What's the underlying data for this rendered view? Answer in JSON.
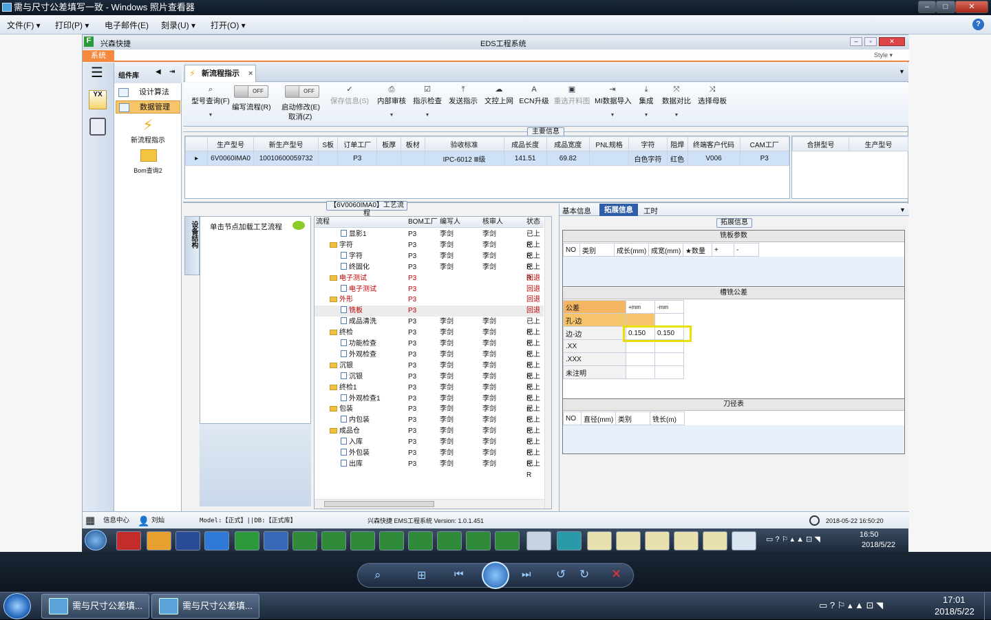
{
  "outer_window": {
    "title": "需与尺寸公差填写一致 - Windows 照片查看器",
    "min": "–",
    "max": "□",
    "close": "✕",
    "help": "?"
  },
  "outer_menu": [
    {
      "label": "文件(F)"
    },
    {
      "label": "打印(P)"
    },
    {
      "label": "电子邮件(E)"
    },
    {
      "label": "刻录(U)"
    },
    {
      "label": "打开(O)"
    }
  ],
  "eds": {
    "app_short": "兴森快捷",
    "title": "EDS工程系统",
    "style": "Style",
    "sys_tab": "系统"
  },
  "complib": {
    "title": "组件库",
    "items": [
      {
        "label": "设计算法"
      },
      {
        "label": "数据管理"
      }
    ],
    "big": [
      {
        "label": "新流程指示"
      },
      {
        "label": "Bom查询2"
      }
    ]
  },
  "doc_tab": {
    "label": "新流程指示",
    "close": "×"
  },
  "ribbon": {
    "query": "型号查询(F)",
    "edit_flow": "编写流程(R)",
    "enable_edit": "启动修改(E)",
    "cancel": "取消(Z)",
    "off": "OFF",
    "buttons": [
      {
        "label": "保存信息(S)",
        "disabled": true
      },
      {
        "label": "内部审核"
      },
      {
        "label": "指示检查"
      },
      {
        "label": "发送指示"
      },
      {
        "label": "文控上网"
      },
      {
        "label": "ECN升级"
      },
      {
        "label": "重选开料图",
        "disabled": true
      },
      {
        "label": "MI数据导入"
      },
      {
        "label": "集成"
      },
      {
        "label": "数据对比"
      },
      {
        "label": "选择母板"
      }
    ]
  },
  "main_info": {
    "title": "主要信息",
    "headers": [
      "生产型号",
      "新生产型号",
      "S板",
      "订单工厂",
      "板厚",
      "板材",
      "验收标准",
      "成品长度",
      "成品宽度",
      "PNL规格",
      "字符",
      "阻焊",
      "终端客户代码",
      "CAM工厂"
    ],
    "row": [
      "6V0060IMA0",
      "10010600059732",
      "",
      "P3",
      "",
      "",
      "IPC-6012 Ⅲ级",
      "141.51",
      "69.82",
      "",
      "白色字符",
      "红色",
      "V006",
      "P3"
    ],
    "side_headers": [
      "合拼型号",
      "生产型号"
    ]
  },
  "process": {
    "title": "【6V0060IMA0】工艺流程",
    "vertical_tab": "设备结构",
    "hint": "单击节点加载工艺流程",
    "headers": [
      "流程",
      "BOM工厂",
      "编写人",
      "核审人",
      "状态"
    ],
    "rows": [
      {
        "name": "显影1",
        "level": 2,
        "folder": false,
        "red": false,
        "bom": "P3",
        "author": "李剑",
        "checker": "李剑",
        "status": "已上R"
      },
      {
        "name": "字符",
        "level": 1,
        "folder": true,
        "red": false,
        "bom": "P3",
        "author": "李剑",
        "checker": "李剑",
        "status": "已上R"
      },
      {
        "name": "字符",
        "level": 2,
        "folder": false,
        "red": false,
        "bom": "P3",
        "author": "李剑",
        "checker": "李剑",
        "status": "已上R"
      },
      {
        "name": "终固化",
        "level": 2,
        "folder": false,
        "red": false,
        "bom": "P3",
        "author": "李剑",
        "checker": "李剑",
        "status": "已上R"
      },
      {
        "name": "电子测试",
        "level": 1,
        "folder": true,
        "red": true,
        "bom": "P3",
        "author": "",
        "checker": "",
        "status": "回退"
      },
      {
        "name": "电子测试",
        "level": 2,
        "folder": false,
        "red": true,
        "bom": "P3",
        "author": "",
        "checker": "",
        "status": "回退"
      },
      {
        "name": "外形",
        "level": 1,
        "folder": true,
        "red": true,
        "bom": "P3",
        "author": "",
        "checker": "",
        "status": "回退"
      },
      {
        "name": "铣板",
        "level": 2,
        "folder": false,
        "red": true,
        "bom": "P3",
        "author": "",
        "checker": "",
        "status": "回退",
        "hl": true
      },
      {
        "name": "成品清洗",
        "level": 2,
        "folder": false,
        "red": false,
        "bom": "P3",
        "author": "李剑",
        "checker": "李剑",
        "status": "已上R"
      },
      {
        "name": "终检",
        "level": 1,
        "folder": true,
        "red": false,
        "bom": "P3",
        "author": "李剑",
        "checker": "李剑",
        "status": "已上R"
      },
      {
        "name": "功能检查",
        "level": 2,
        "folder": false,
        "red": false,
        "bom": "P3",
        "author": "李剑",
        "checker": "李剑",
        "status": "已上R"
      },
      {
        "name": "外观检查",
        "level": 2,
        "folder": false,
        "red": false,
        "bom": "P3",
        "author": "李剑",
        "checker": "李剑",
        "status": "已上R"
      },
      {
        "name": "沉银",
        "level": 1,
        "folder": true,
        "red": false,
        "bom": "P3",
        "author": "李剑",
        "checker": "李剑",
        "status": "已上R"
      },
      {
        "name": "沉银",
        "level": 2,
        "folder": false,
        "red": false,
        "bom": "P3",
        "author": "李剑",
        "checker": "李剑",
        "status": "已上R"
      },
      {
        "name": "终检1",
        "level": 1,
        "folder": true,
        "red": false,
        "bom": "P3",
        "author": "李剑",
        "checker": "李剑",
        "status": "已上R"
      },
      {
        "name": "外观检查1",
        "level": 2,
        "folder": false,
        "red": false,
        "bom": "P3",
        "author": "李剑",
        "checker": "李剑",
        "status": "已上R"
      },
      {
        "name": "包装",
        "level": 1,
        "folder": true,
        "red": false,
        "bom": "P3",
        "author": "李剑",
        "checker": "李剑",
        "status": "已上R"
      },
      {
        "name": "内包装",
        "level": 2,
        "folder": false,
        "red": false,
        "bom": "P3",
        "author": "李剑",
        "checker": "李剑",
        "status": "已上R"
      },
      {
        "name": "成品仓",
        "level": 1,
        "folder": true,
        "red": false,
        "bom": "P3",
        "author": "李剑",
        "checker": "李剑",
        "status": "已上R"
      },
      {
        "name": "入库",
        "level": 2,
        "folder": false,
        "red": false,
        "bom": "P3",
        "author": "李剑",
        "checker": "李剑",
        "status": "已上R"
      },
      {
        "name": "外包装",
        "level": 2,
        "folder": false,
        "red": false,
        "bom": "P3",
        "author": "李剑",
        "checker": "李剑",
        "status": "已上R"
      },
      {
        "name": "出库",
        "level": 2,
        "folder": false,
        "red": false,
        "bom": "P3",
        "author": "李剑",
        "checker": "李剑",
        "status": "已上R"
      }
    ]
  },
  "right": {
    "tabs": [
      "基本信息",
      "拓展信息",
      "工时"
    ],
    "ext_title": "拓展信息",
    "board": {
      "title": "铣板参数",
      "headers": [
        "NO",
        "类别",
        "成长(mm)",
        "成宽(mm)",
        "★数量",
        "+",
        "-"
      ]
    },
    "tol": {
      "title": "槽铣公差",
      "headers": [
        "公差",
        "+mm",
        "-mm"
      ],
      "rows": [
        [
          "孔-边",
          "",
          ""
        ],
        [
          "边-边",
          "0.150",
          "0.150"
        ],
        [
          ".XX",
          "",
          ""
        ],
        [
          ".XXX",
          "",
          ""
        ],
        [
          "未注明",
          "",
          ""
        ]
      ]
    },
    "knife": {
      "title": "刀径表",
      "headers": [
        "NO",
        "直径(mm)",
        "类别",
        "铣长(m)"
      ]
    }
  },
  "status": {
    "info_center": "信息中心",
    "user": "刘灿",
    "model": "Model:【正式】||DB:【正式库】",
    "version": "兴森快捷 EMS工程系统 Version: 1.0.1.451",
    "datetime": "2018-05-22 16:50:20"
  },
  "inner_tray": {
    "time": "16:50",
    "date": "2018/5/22"
  },
  "taskbar": {
    "items": [
      {
        "label": "需与尺寸公差填..."
      },
      {
        "label": "需与尺寸公差填..."
      }
    ],
    "time": "17:01",
    "date": "2018/5/22"
  },
  "colors": {
    "accent": "#f4893f",
    "selection": "#cfe1f7",
    "highlight": "#e8e000",
    "red": "#c00000"
  }
}
